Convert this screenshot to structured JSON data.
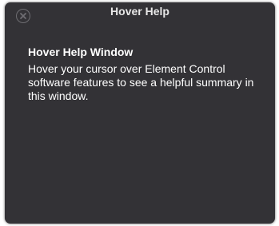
{
  "window": {
    "title": "Hover Help",
    "close_icon": "close-icon"
  },
  "content": {
    "heading": "Hover Help Window",
    "body": "Hover your cursor over Element Control software features to see a helpful summary in this window."
  },
  "colors": {
    "background": "#333236",
    "text": "#ffffff",
    "close_button_ring": "#6e6d72"
  }
}
